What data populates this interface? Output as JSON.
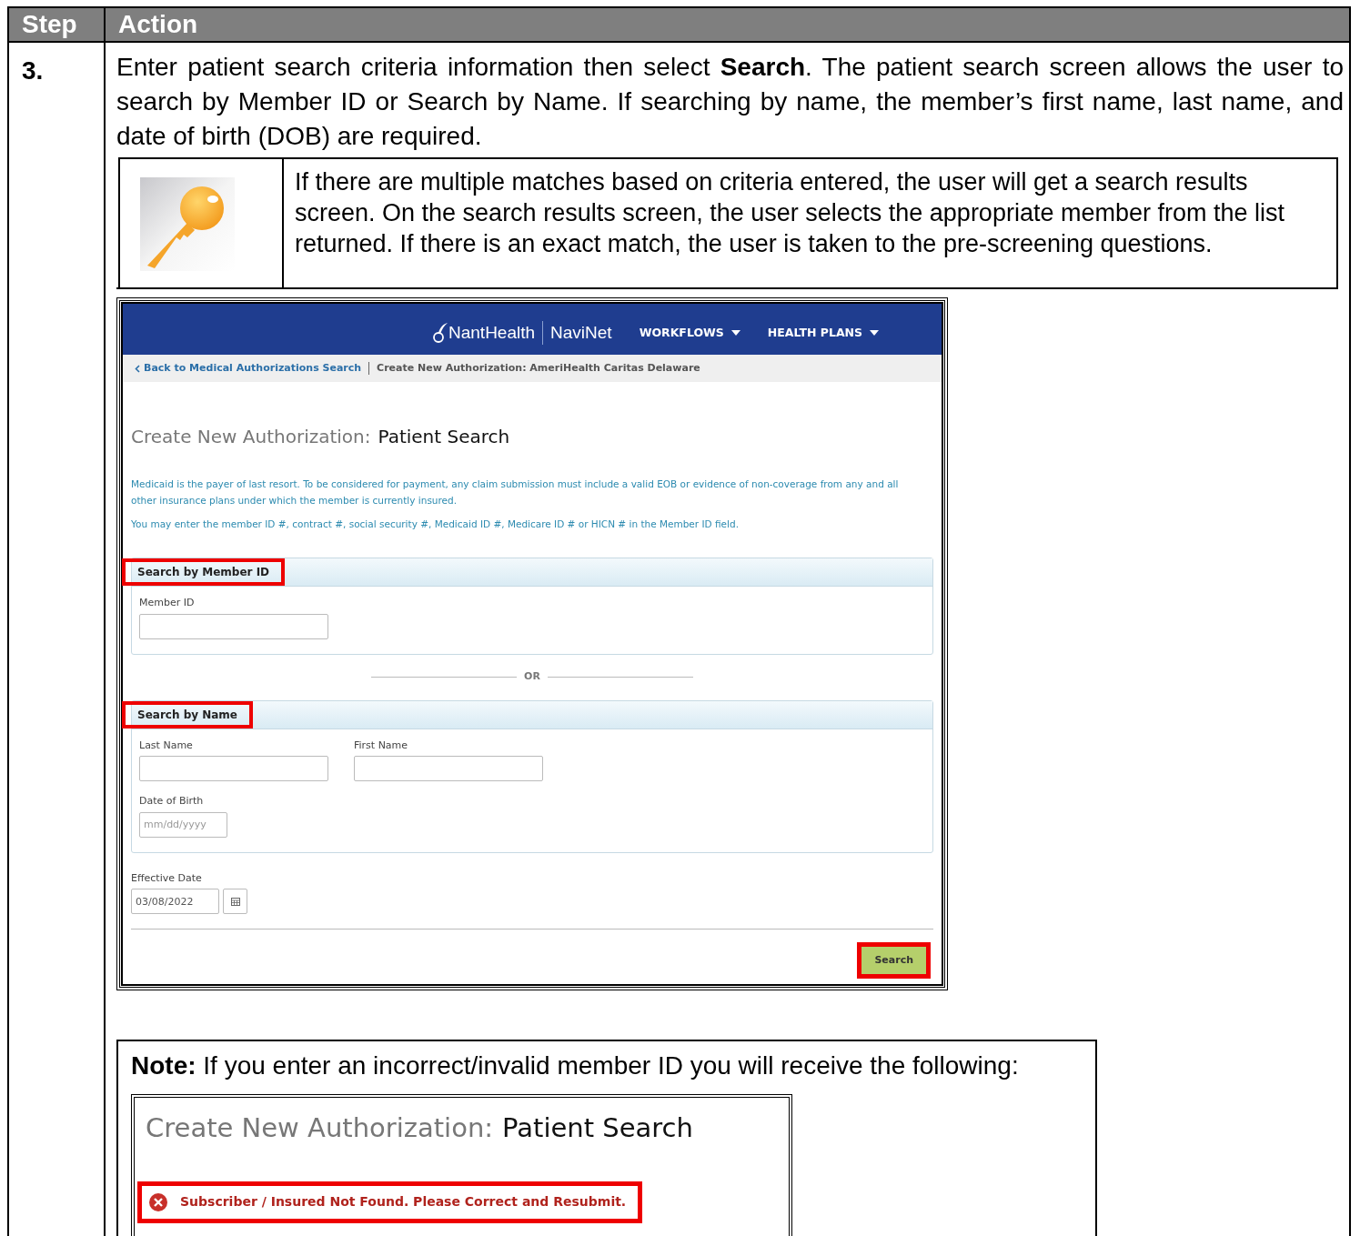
{
  "table": {
    "columns": [
      "Step",
      "Action"
    ],
    "rows": [
      {
        "step": "3.",
        "intro": "Enter patient search criteria information then select **Search**. The patient search screen allows the user to search by Member ID or Search by Name. If searching by name, the member’s first name, last name, and date of birth (DOB) are required.",
        "tip": "If there are multiple matches based on criteria entered, the user will get a search results screen. On the search results screen, the user selects the appropriate member from the list returned. If there is an exact match, the user is taken to the pre-screening questions.",
        "screenshot": {
          "brand": "NantHealth",
          "product": "NaviNet",
          "menus": [
            {
              "label": "WORKFLOWS"
            },
            {
              "label": "HEALTH PLANS"
            }
          ],
          "back_link": "Back to Medical Authorizations Search",
          "breadcrumb": "Create New Authorization: AmeriHealth Caritas Delaware",
          "heading_prefix": "Create New Authorization:",
          "heading": "Patient Search",
          "info": [
            "Medicaid is the payer of last resort. To be considered for payment, any claim submission must include a valid EOB or evidence of non-coverage from any and all other insurance plans under which the member is currently insured.",
            "You may enter the member ID #, contract #, social security #, Medicaid ID #, Medicare ID # or HICN # in the Member ID field."
          ],
          "panels": [
            {
              "title": "Search by Member ID",
              "highlighted": true,
              "fields": [
                {
                  "label": "Member ID",
                  "kind": "text"
                }
              ]
            },
            {
              "title": "Search by Name",
              "highlighted": true,
              "fields": [
                {
                  "label": "Last Name",
                  "kind": "text"
                },
                {
                  "label": "First Name",
                  "kind": "text"
                },
                {
                  "label": "Date of Birth",
                  "kind": "date",
                  "placeholder": "mm/dd/yyyy"
                }
              ]
            }
          ],
          "divider": "OR",
          "effective_date": {
            "label": "Effective Date",
            "value": "03/08/2022"
          },
          "search_button": {
            "label": "Search",
            "highlighted": true
          }
        },
        "note": {
          "label": "Note:",
          "text": "If you enter an incorrect/invalid member ID you will receive the following:",
          "heading_prefix": "Create New Authorization:",
          "heading": "Patient Search",
          "error": "Subscriber / Insured Not Found. Please Correct and Resubmit.",
          "highlighted": true
        }
      }
    ]
  }
}
